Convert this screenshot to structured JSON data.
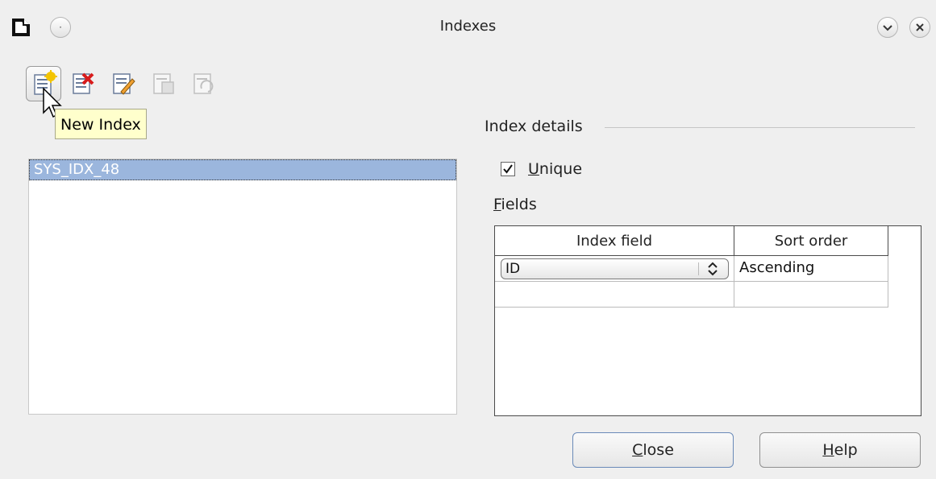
{
  "window": {
    "title": "Indexes"
  },
  "toolbar": {
    "buttons": [
      {
        "icon": "new-index-icon"
      },
      {
        "icon": "delete-index-icon"
      },
      {
        "icon": "rename-index-icon"
      },
      {
        "icon": "save-index-icon"
      },
      {
        "icon": "reset-index-icon"
      }
    ],
    "tooltip": "New Index"
  },
  "index_list": {
    "items": [
      "SYS_IDX_48"
    ],
    "selected": "SYS_IDX_48"
  },
  "details": {
    "heading": "Index details",
    "unique_label_mnemonic": "U",
    "unique_label_rest": "nique",
    "unique_checked": true,
    "fields_label_mnemonic": "F",
    "fields_label_rest": "ields",
    "columns": [
      "Index field",
      "Sort order"
    ],
    "rows": [
      {
        "field": "ID",
        "sort": "Ascending"
      },
      {
        "field": "",
        "sort": ""
      }
    ]
  },
  "buttons": {
    "close_mnemonic": "C",
    "close_rest": "lose",
    "help_mnemonic": "H",
    "help_rest": "elp"
  },
  "colors": {
    "selection": "#9bb6dd",
    "tooltip_bg": "#ffffcc",
    "window_bg": "#efefef"
  }
}
